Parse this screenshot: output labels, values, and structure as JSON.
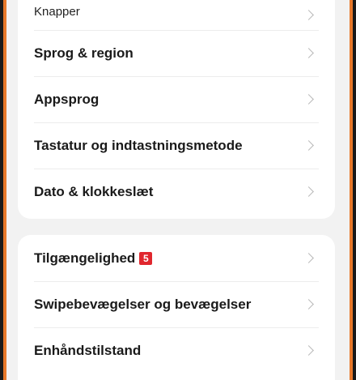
{
  "settings": {
    "group1": {
      "partial_item": "Knapper",
      "items": [
        {
          "label": "Sprog & region"
        },
        {
          "label": "Appsprog"
        },
        {
          "label": "Tastatur og indtastningsmetode"
        },
        {
          "label": "Dato & klokkeslæt"
        }
      ]
    },
    "group2": {
      "items": [
        {
          "label": "Tilgængelighed",
          "badge": "5"
        },
        {
          "label": "Swipebevægelser og bevægelser"
        },
        {
          "label": "Enhåndstilstand"
        }
      ]
    }
  },
  "colors": {
    "badge": "#e0272e",
    "frame_accent": "#e8782a",
    "card": "#ffffff",
    "background": "#f2f2f2"
  },
  "icons": {
    "row_arrow": "chevron-right-icon"
  }
}
